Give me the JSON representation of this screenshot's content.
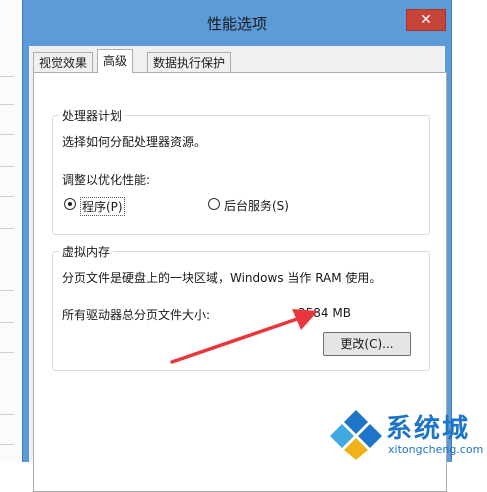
{
  "window": {
    "title": "性能选项",
    "close_glyph": "✕"
  },
  "tabs": [
    {
      "label": "视觉效果"
    },
    {
      "label": "高级"
    },
    {
      "label": "数据执行保护"
    }
  ],
  "processor": {
    "legend": "处理器计划",
    "description": "选择如何分配处理器资源。",
    "adjust_label": "调整以优化性能:",
    "options": [
      {
        "label": "程序(P)",
        "checked": true
      },
      {
        "label": "后台服务(S)",
        "checked": false
      }
    ]
  },
  "virtual_memory": {
    "legend": "虚拟内存",
    "description": "分页文件是硬盘上的一块区域，Windows 当作 RAM 使用。",
    "total_label": "所有驱动器总分页文件大小:",
    "total_value": "3584 MB",
    "change_button": "更改(C)..."
  },
  "watermark": {
    "text_cn": "系统城",
    "text_en": "xitongcheng.com"
  },
  "colors": {
    "title_bar": "#5c9ad8",
    "close_button": "#c7443a",
    "annotation_arrow": "#e8373c",
    "watermark": "#1e74c9"
  }
}
